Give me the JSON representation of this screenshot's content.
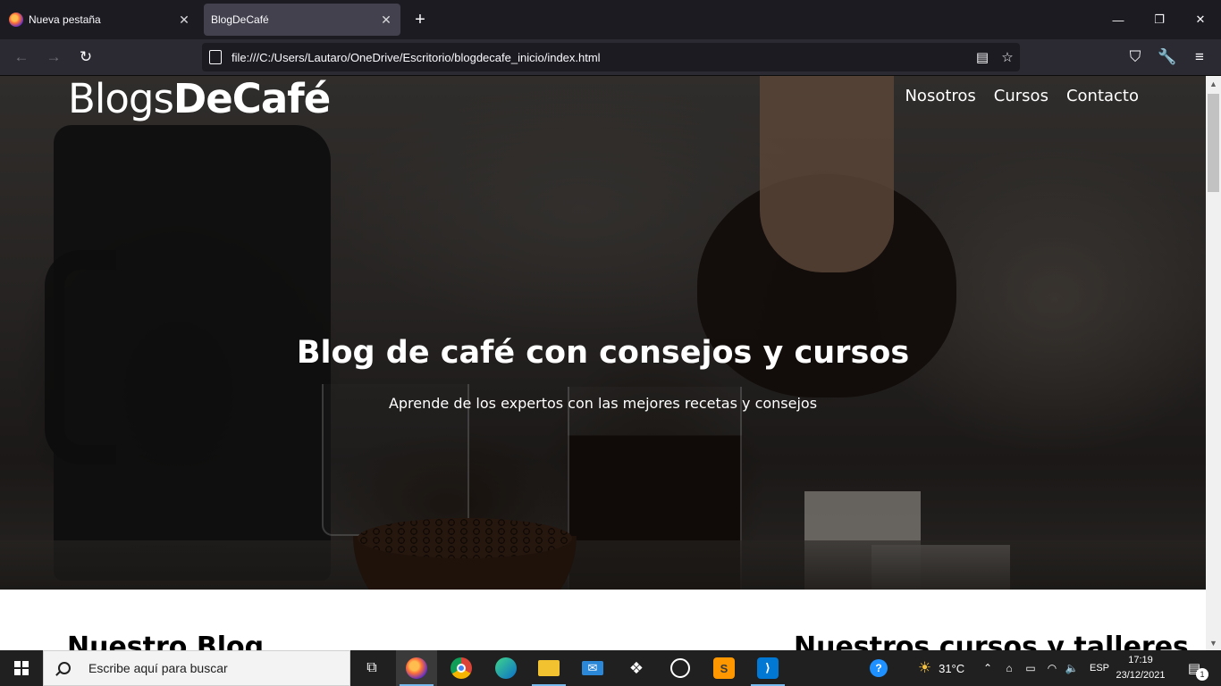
{
  "browser": {
    "tabs": [
      {
        "label": "Nueva pestaña",
        "active": false
      },
      {
        "label": "BlogDeCafé",
        "active": true
      }
    ],
    "new_tab_icon": "plus-icon",
    "url": "file:///C:/Users/Lautaro/OneDrive/Escritorio/blogdecafe_inicio/index.html",
    "window_controls": [
      "minimize-icon",
      "restore-icon",
      "close-icon"
    ]
  },
  "page": {
    "logo_light": "Blogs",
    "logo_bold": "DeCafé",
    "nav": [
      "Nosotros",
      "Cursos",
      "Contacto"
    ],
    "hero_title": "Blog de café con consejos y cursos",
    "hero_subtitle": "Aprende de los expertos con las mejores recetas y consejos",
    "section_blog": "Nuestro Blog",
    "section_courses": "Nuestros cursos y talleres"
  },
  "taskbar": {
    "search_placeholder": "Escribe aquí para buscar",
    "apps": [
      "task-view-icon",
      "firefox-icon",
      "chrome-icon",
      "edge-icon",
      "file-explorer-icon",
      "mail-icon",
      "dropbox-icon",
      "github-icon",
      "sublime-text-icon",
      "vscode-icon"
    ],
    "weather": "31°C",
    "language": "ESP",
    "time": "17:19",
    "date": "23/12/2021",
    "notification_count": "1"
  },
  "colors": {
    "chrome_bg": "#1c1b22",
    "toolbar_bg": "#2b2a33",
    "active_tab": "#42414d",
    "taskbar_bg": "#202020",
    "accent": "#76b9ed"
  }
}
